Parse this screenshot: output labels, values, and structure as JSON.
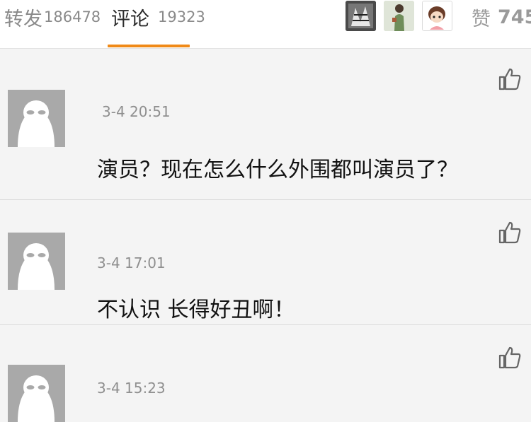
{
  "tabs": {
    "forward": {
      "label": "转发",
      "count": "186478"
    },
    "comments": {
      "label": "评论",
      "count": "19323"
    },
    "likes": {
      "label": "赞",
      "count": "745"
    }
  },
  "accent_color": "#f08a18",
  "comments": [
    {
      "time": "3-4  20:51",
      "text": "演员？现在怎么什么外围都叫演员了？"
    },
    {
      "time": "3-4 17:01",
      "text": "不认识 长得好丑啊！"
    },
    {
      "time": "3-4 15:23",
      "text": ""
    }
  ]
}
